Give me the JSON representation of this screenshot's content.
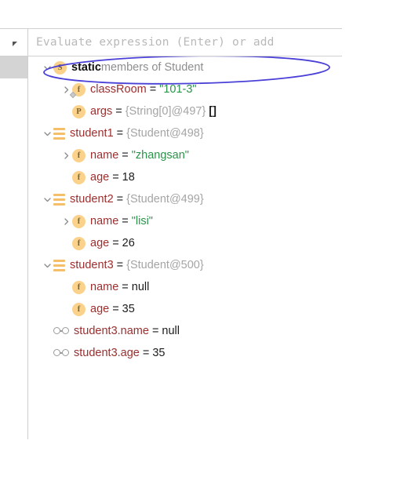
{
  "panel": {
    "evaluate": {
      "placeholder": "Evaluate expression (Enter) or add",
      "collapse_icon": "triangle-collapse-icon"
    }
  },
  "tree": {
    "rows": [
      {
        "id": "static-members",
        "indent": 0,
        "chevron": "down",
        "icon": "static-field-badge",
        "icon_letter": "S",
        "label_bold": "static",
        "label_rest": " members of Student",
        "selected": true,
        "annotated": true
      },
      {
        "id": "classroom",
        "indent": 1,
        "chevron": "right",
        "icon": "static-field-badge",
        "icon_letter": "f",
        "static_marker": true,
        "name": "classRoom",
        "eq": "=",
        "value": "\"101-3\"",
        "value_kind": "string"
      },
      {
        "id": "args",
        "indent": 1,
        "chevron": "none",
        "icon": "parameter-badge",
        "icon_letter": "P",
        "name": "args",
        "eq": "=",
        "value": "{String[0]@497}",
        "value_kind": "ref",
        "suffix": "[]",
        "suffix_kind": "brackets"
      },
      {
        "id": "student1",
        "indent": 0,
        "chevron": "down",
        "icon": "object-node-icon",
        "name": "student1",
        "eq": "=",
        "value": "{Student@498}",
        "value_kind": "ref"
      },
      {
        "id": "student1-name",
        "indent": 1,
        "chevron": "right",
        "icon": "field-badge",
        "icon_letter": "f",
        "name": "name",
        "eq": "=",
        "value": "\"zhangsan\"",
        "value_kind": "string"
      },
      {
        "id": "student1-age",
        "indent": 1,
        "chevron": "none",
        "icon": "field-badge",
        "icon_letter": "f",
        "name": "age",
        "eq": "=",
        "value": "18",
        "value_kind": "number"
      },
      {
        "id": "student2",
        "indent": 0,
        "chevron": "down",
        "icon": "object-node-icon",
        "name": "student2",
        "eq": "=",
        "value": "{Student@499}",
        "value_kind": "ref"
      },
      {
        "id": "student2-name",
        "indent": 1,
        "chevron": "right",
        "icon": "field-badge",
        "icon_letter": "f",
        "name": "name",
        "eq": "=",
        "value": "\"lisi\"",
        "value_kind": "string"
      },
      {
        "id": "student2-age",
        "indent": 1,
        "chevron": "none",
        "icon": "field-badge",
        "icon_letter": "f",
        "name": "age",
        "eq": "=",
        "value": "26",
        "value_kind": "number"
      },
      {
        "id": "student3",
        "indent": 0,
        "chevron": "down",
        "icon": "object-node-icon",
        "name": "student3",
        "eq": "=",
        "value": "{Student@500}",
        "value_kind": "ref"
      },
      {
        "id": "student3-name",
        "indent": 1,
        "chevron": "none",
        "icon": "field-badge",
        "icon_letter": "f",
        "name": "name",
        "eq": "=",
        "value": "null",
        "value_kind": "null"
      },
      {
        "id": "student3-age",
        "indent": 1,
        "chevron": "none",
        "icon": "field-badge",
        "icon_letter": "f",
        "name": "age",
        "eq": "=",
        "value": "35",
        "value_kind": "number"
      },
      {
        "id": "watch-student3-name",
        "indent": 0,
        "chevron": "none",
        "icon": "watch-glasses-icon",
        "name": "student3.name",
        "eq": "=",
        "value": "null",
        "value_kind": "null"
      },
      {
        "id": "watch-student3-age",
        "indent": 0,
        "chevron": "none",
        "icon": "watch-glasses-icon",
        "name": "student3.age",
        "eq": "=",
        "value": "35",
        "value_kind": "number"
      }
    ]
  },
  "annotation": {
    "shape": "ellipse",
    "color": "#4a40d8",
    "target_row": "static-members"
  },
  "colors": {
    "name": "#9c2e2e",
    "string_value": "#2a9449",
    "reference": "#a5a5a5",
    "icon_orange": "#fbd28b",
    "annotation_blue": "#4a40d8",
    "selection_grey": "#d4d4d4"
  }
}
